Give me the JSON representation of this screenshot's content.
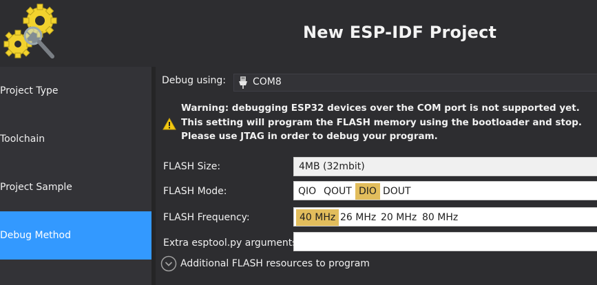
{
  "header": {
    "title": "New ESP-IDF Project",
    "logo_icon": "gears-magnifier-icon"
  },
  "sidebar": {
    "items": [
      {
        "label": "Project Type",
        "active": false
      },
      {
        "label": "Toolchain",
        "active": false
      },
      {
        "label": "Project Sample",
        "active": false
      },
      {
        "label": "Debug Method",
        "active": true
      }
    ],
    "active_color": "#3399ff"
  },
  "debug": {
    "label": "Debug using:",
    "value": "COM8",
    "icon": "usb-plug-icon"
  },
  "warning": {
    "icon": "warning-triangle-icon",
    "lines": [
      "Warning: debugging ESP32 devices over the COM port is not supported yet.",
      "This setting will program the FLASH memory using the bootloader and stop.",
      "Please use JTAG in order to debug your program."
    ]
  },
  "flash": {
    "size_label": "FLASH Size:",
    "size_value": "4MB (32mbit)",
    "mode_label": "FLASH Mode:",
    "mode_options": [
      "QIO",
      "QOUT",
      "DIO",
      "DOUT"
    ],
    "mode_selected": "DIO",
    "freq_label": "FLASH Frequency:",
    "freq_options": [
      "40 MHz",
      "26 MHz",
      "20 MHz",
      "80 MHz"
    ],
    "freq_selected": "40 MHz",
    "extra_label": "Extra esptool.py arguments:",
    "extra_value": "",
    "selected_color": "#e2bd5c"
  },
  "additional": {
    "label": "Additional FLASH resources to program",
    "icon": "chevron-down-circle-icon"
  }
}
